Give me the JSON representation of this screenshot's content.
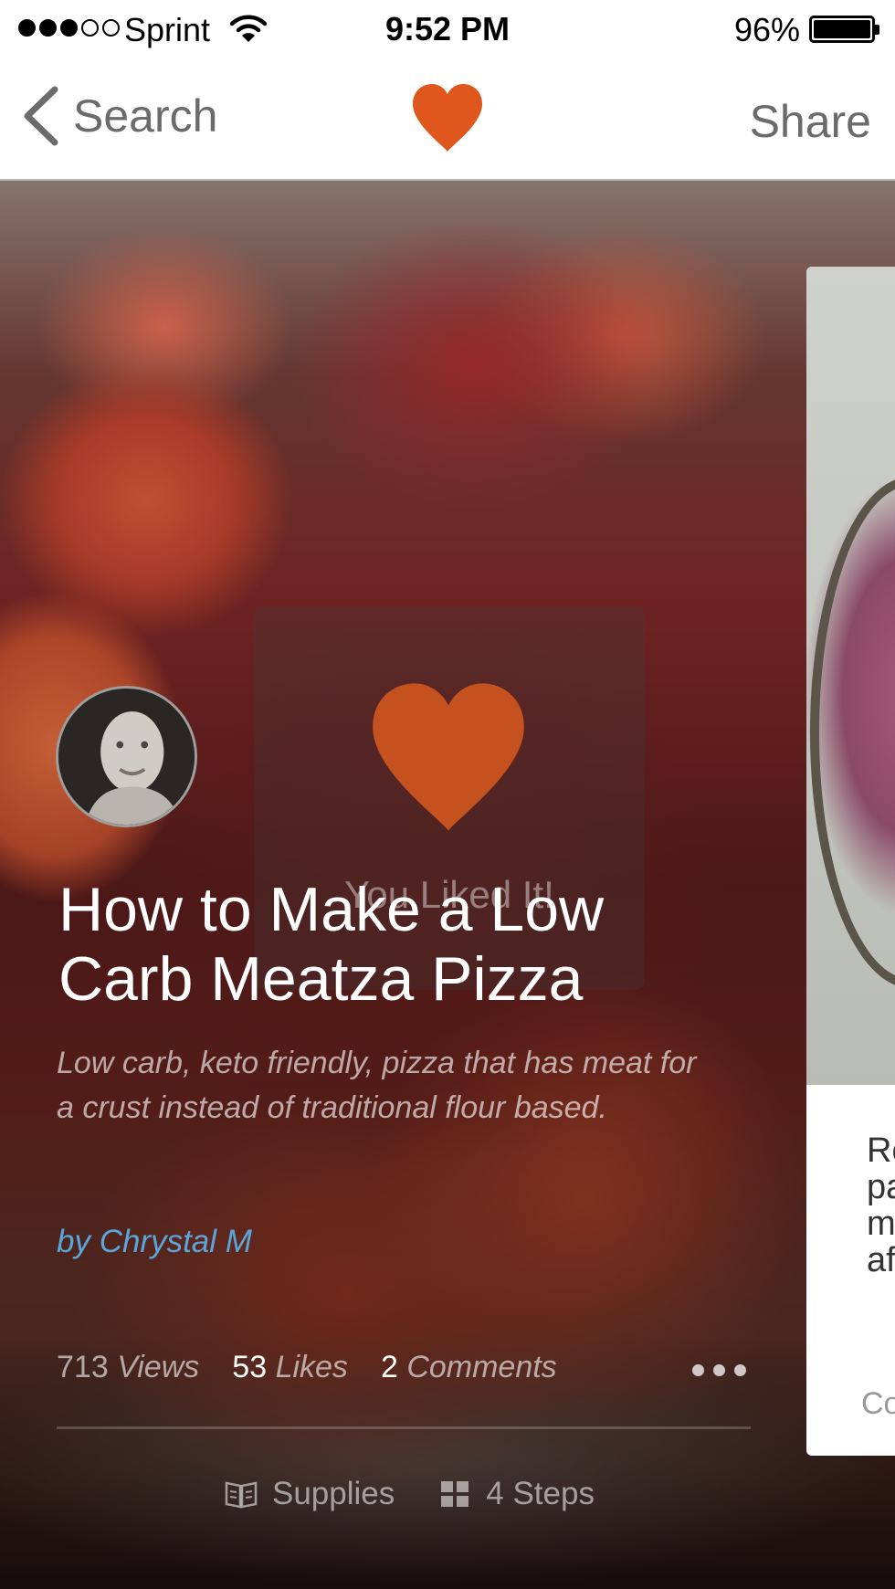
{
  "status_bar": {
    "carrier": "Sprint",
    "signal_bars_filled": 3,
    "signal_bars_total": 5,
    "time": "9:52 PM",
    "battery_percent": "96%"
  },
  "nav": {
    "back_label": "Search",
    "share_label": "Share",
    "accent_color": "#e0571e"
  },
  "overlay": {
    "liked_text": "You Liked It!"
  },
  "project": {
    "title": "How to Make a Low Carb Meatza Pizza",
    "description": "Low carb, keto friendly, pizza that has meat for a crust instead of traditional flour based.",
    "author": "by Chrystal M"
  },
  "stats": {
    "views_count": "713",
    "views_label": "Views",
    "likes_count": "53",
    "likes_label": "Likes",
    "comments_count": "2",
    "comments_label": "Comments"
  },
  "bottom_links": {
    "supplies_label": "Supplies",
    "steps_label": "4 Steps"
  },
  "next_card": {
    "text": "Ro\npa\nm\naf",
    "footer": "Co"
  }
}
